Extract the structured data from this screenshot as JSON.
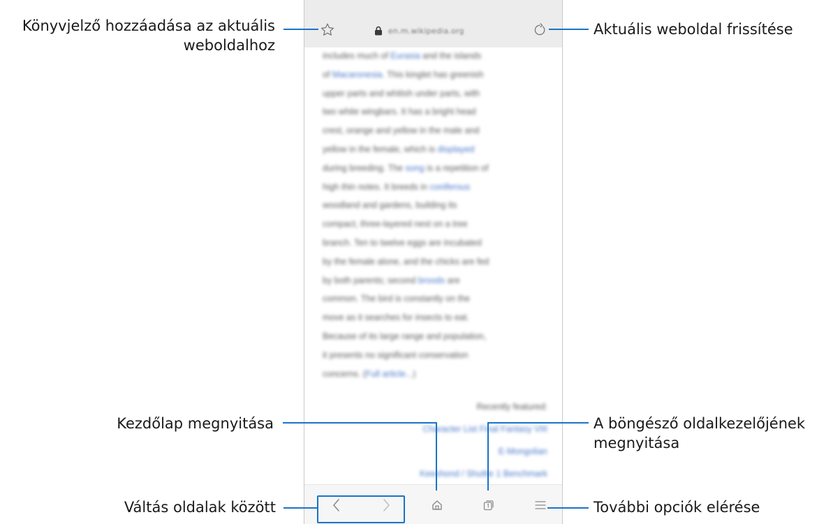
{
  "browser": {
    "url": "en.m.wikipedia.org",
    "content_paragraph": [
      {
        "parts": [
          {
            "t": "includes much of "
          },
          {
            "t": "Eurasia",
            "link": true
          },
          {
            "t": " and the islands"
          }
        ]
      },
      {
        "parts": [
          {
            "t": "of "
          },
          {
            "t": "Macaronesia",
            "link": true
          },
          {
            "t": ". This kinglet has greenish"
          }
        ]
      },
      {
        "parts": [
          {
            "t": "upper parts and whitish under parts, with"
          }
        ]
      },
      {
        "parts": [
          {
            "t": "two white wingbars. It has a bright head"
          }
        ]
      },
      {
        "parts": [
          {
            "t": "crest, orange and yellow in the male and"
          }
        ]
      },
      {
        "parts": [
          {
            "t": "yellow in the female, which is "
          },
          {
            "t": "displayed",
            "link": true
          }
        ]
      },
      {
        "parts": [
          {
            "t": "during breeding. The "
          },
          {
            "t": "song",
            "link": true
          },
          {
            "t": " is a repetition of"
          }
        ]
      },
      {
        "parts": [
          {
            "t": "high thin notes. It breeds in "
          },
          {
            "t": "coniferous",
            "link": true
          }
        ]
      },
      {
        "parts": [
          {
            "t": "woodland and gardens, building its"
          }
        ]
      },
      {
        "parts": [
          {
            "t": "compact, three-layered nest on a tree"
          }
        ]
      },
      {
        "parts": [
          {
            "t": "branch. Ten to twelve eggs are incubated"
          }
        ]
      },
      {
        "parts": [
          {
            "t": "by the female alone, and the chicks are fed"
          }
        ]
      },
      {
        "parts": [
          {
            "t": "by both parents; second "
          },
          {
            "t": "broods",
            "link": true
          },
          {
            "t": " are"
          }
        ]
      },
      {
        "parts": [
          {
            "t": "common. The bird is constantly on the"
          }
        ]
      },
      {
        "parts": [
          {
            "t": "move as it searches for insects to eat."
          }
        ]
      },
      {
        "parts": [
          {
            "t": "Because of its large range and population,"
          }
        ]
      },
      {
        "parts": [
          {
            "t": "it presents no significant conservation"
          }
        ]
      },
      {
        "parts": [
          {
            "t": "concerns. ("
          },
          {
            "t": "Full article...",
            "link": true
          },
          {
            "t": ")"
          }
        ]
      }
    ],
    "recently_featured": "Recently featured:",
    "featured_links": [
      "Character List Final Fantasy VIII",
      "E-Mongolian",
      "Keeshond / Shuttle 1 Benchmark"
    ]
  },
  "callouts": {
    "bookmark_line1": "Könyvjelző hozzáadása az aktuális",
    "bookmark_line2": "weboldalhoz",
    "refresh": "Aktuális weboldal frissítése",
    "home": "Kezdőlap megnyitása",
    "tabs_line1": "A böngésző oldalkezelőjének",
    "tabs_line2": "megnyitása",
    "navigate": "Váltás oldalak között",
    "more": "További opciók elérése"
  },
  "colors": {
    "accent": "#1a73c7",
    "url_bar": "#ececec",
    "link": "#4a78c9"
  },
  "icons": [
    "star-icon",
    "lock-icon",
    "refresh-icon",
    "back-icon",
    "forward-icon",
    "home-icon",
    "tabs-icon",
    "menu-icon"
  ]
}
